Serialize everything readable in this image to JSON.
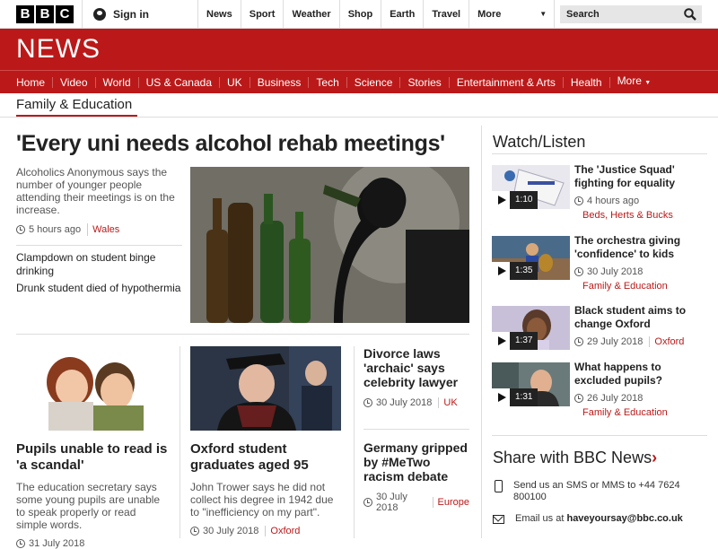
{
  "brand": {
    "letters": [
      "B",
      "B",
      "C"
    ],
    "news_word": "NEWS",
    "accent": "#bb1919"
  },
  "topbar": {
    "signin_label": "Sign in",
    "nav": [
      "News",
      "Sport",
      "Weather",
      "Shop",
      "Earth",
      "Travel"
    ],
    "more_label": "More",
    "search_placeholder": "Search"
  },
  "mainnav": [
    "Home",
    "Video",
    "World",
    "US & Canada",
    "UK",
    "Business",
    "Tech",
    "Science",
    "Stories",
    "Entertainment & Arts",
    "Health",
    "More"
  ],
  "section": {
    "title": "Family & Education"
  },
  "lead": {
    "headline": "'Every uni needs alcohol rehab meetings'",
    "summary": "Alcoholics Anonymous says the number of younger people attending their meetings is on the increase.",
    "time": "5 hours ago",
    "tag": "Wales",
    "related": [
      "Clampdown on student binge drinking",
      "Drunk student died of hypothermia"
    ]
  },
  "cards": [
    {
      "title": "Pupils unable to read is 'a scandal'",
      "text": "The education secretary says some young pupils are unable to speak properly or read simple words.",
      "date": "31 July 2018"
    },
    {
      "title": "Oxford student graduates aged 95",
      "text": "John Trower says he did not collect his degree in 1942 due to \"inefficiency on my part\".",
      "date": "30 July 2018",
      "tag": "Oxford"
    },
    {
      "title": "Divorce laws 'archaic' says celebrity lawyer",
      "date": "30 July 2018",
      "tag": "UK"
    },
    {
      "title": "Germany gripped by #MeTwo racism debate",
      "date": "30 July 2018",
      "tag": "Europe"
    }
  ],
  "watch": {
    "title": "Watch/Listen",
    "items": [
      {
        "title": "The 'Justice Squad' fighting for equality",
        "duration": "1:10",
        "time": "4 hours ago",
        "tag": "Beds, Herts & Bucks"
      },
      {
        "title": "The orchestra giving 'confidence' to kids",
        "duration": "1:35",
        "time": "30 July 2018",
        "tag": "Family & Education"
      },
      {
        "title": "Black student aims to change Oxford",
        "duration": "1:37",
        "time": "29 July 2018",
        "tag": "Oxford"
      },
      {
        "title": "What happens to excluded pupils?",
        "duration": "1:31",
        "time": "26 July 2018",
        "tag": "Family & Education"
      }
    ]
  },
  "share": {
    "title": "Share with BBC News",
    "sms": "Send us an SMS or MMS to +44 7624 800100",
    "email_prefix": "Email us at ",
    "email": "haveyoursay@bbc.co.uk"
  }
}
